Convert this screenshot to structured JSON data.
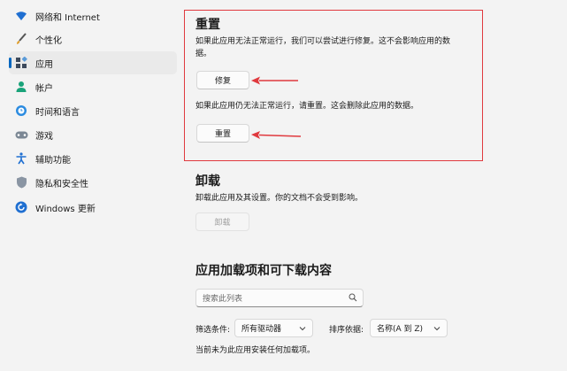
{
  "sidebar": {
    "items": [
      {
        "label": "网络和 Internet",
        "icon": "wifi-icon"
      },
      {
        "label": "个性化",
        "icon": "brush-icon"
      },
      {
        "label": "应用",
        "icon": "apps-icon"
      },
      {
        "label": "帐户",
        "icon": "person-icon"
      },
      {
        "label": "时间和语言",
        "icon": "globe-clock-icon"
      },
      {
        "label": "游戏",
        "icon": "gamepad-icon"
      },
      {
        "label": "辅助功能",
        "icon": "accessibility-icon"
      },
      {
        "label": "隐私和安全性",
        "icon": "shield-icon"
      },
      {
        "label": "Windows 更新",
        "icon": "update-icon"
      }
    ],
    "active_index": 2
  },
  "reset": {
    "title": "重置",
    "repair_desc_line1": "如果此应用无法正常运行，我们可以尝试进行修复。这不会影响应用的数",
    "repair_desc_line2": "据。",
    "repair_button": "修复",
    "reset_desc": "如果此应用仍无法正常运行，请重置。这会删除此应用的数据。",
    "reset_button": "重置"
  },
  "uninstall": {
    "title": "卸载",
    "desc": "卸载此应用及其设置。你的文档不会受到影响。",
    "button": "卸载"
  },
  "addons": {
    "title": "应用加载项和可下载内容",
    "search_placeholder": "搜索此列表",
    "filter_label": "筛选条件:",
    "filter_value": "所有驱动器",
    "sort_label": "排序依据:",
    "sort_value": "名称(A 到 Z)",
    "empty_text": "当前未为此应用安装任何加载项。"
  },
  "colors": {
    "accent": "#0067c0",
    "annotation_red": "#e0393e"
  }
}
